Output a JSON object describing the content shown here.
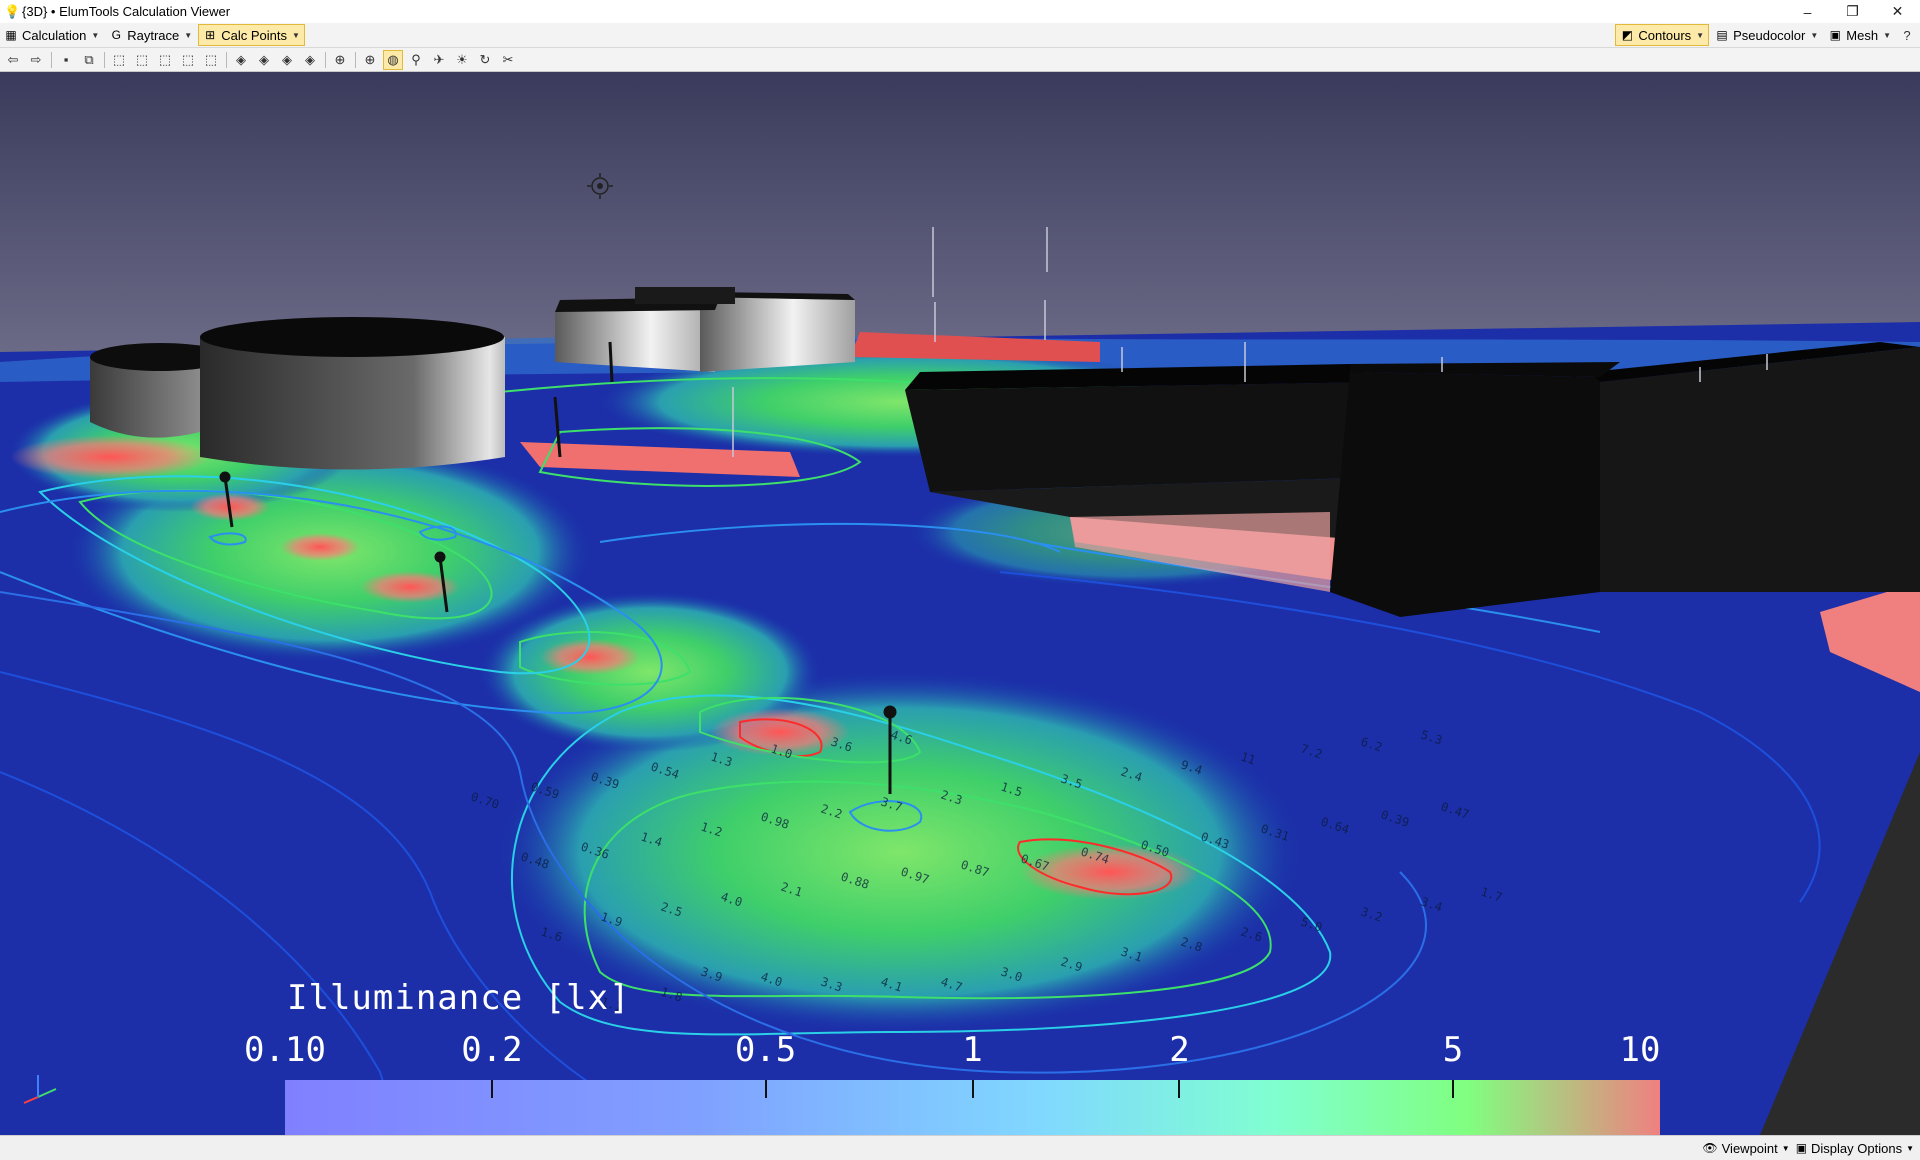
{
  "window": {
    "title": "{3D} • ElumTools Calculation Viewer",
    "controls": [
      "–",
      "❐",
      "✕"
    ]
  },
  "toolbar": {
    "left": [
      {
        "label": "Calculation",
        "icon": "calculator-icon",
        "glyph": "▦"
      },
      {
        "label": "Raytrace",
        "icon": "raytrace-icon",
        "glyph": "G"
      },
      {
        "label": "Calc Points",
        "icon": "grid-points-icon",
        "glyph": "⊞",
        "active": true
      }
    ],
    "right": [
      {
        "label": "Contours",
        "icon": "contours-icon",
        "glyph": "◩",
        "active": true
      },
      {
        "label": "Pseudocolor",
        "icon": "pseudocolor-icon",
        "glyph": "▤"
      },
      {
        "label": "Mesh",
        "icon": "mesh-icon",
        "glyph": "▣"
      }
    ],
    "help_glyph": "?"
  },
  "toolbar2": {
    "buttons": [
      {
        "name": "back-icon",
        "glyph": "⇦"
      },
      {
        "name": "forward-icon",
        "glyph": "⇨"
      },
      {
        "sep": true
      },
      {
        "name": "save-icon",
        "glyph": "▪"
      },
      {
        "name": "copy-icon",
        "glyph": "⧉"
      },
      {
        "sep": true
      },
      {
        "name": "view-top-icon",
        "glyph": "⬚"
      },
      {
        "name": "view-front-icon",
        "glyph": "⬚"
      },
      {
        "name": "view-side-icon",
        "glyph": "⬚"
      },
      {
        "name": "view-iso-icon",
        "glyph": "⬚"
      },
      {
        "name": "view-persp-icon",
        "glyph": "⬚"
      },
      {
        "sep": true
      },
      {
        "name": "orbit-icon",
        "glyph": "◈"
      },
      {
        "name": "pan-icon",
        "glyph": "◈"
      },
      {
        "name": "rotate-icon",
        "glyph": "◈"
      },
      {
        "name": "spin-icon",
        "glyph": "◈"
      },
      {
        "sep": true
      },
      {
        "name": "zoom-window-icon",
        "glyph": "⊕"
      },
      {
        "sep": true
      },
      {
        "name": "zoom-icon",
        "glyph": "⊕"
      },
      {
        "name": "globe-icon",
        "glyph": "◍",
        "active": true
      },
      {
        "name": "walk-icon",
        "glyph": "⚲"
      },
      {
        "name": "fly-icon",
        "glyph": "✈"
      },
      {
        "name": "lightbulb-icon",
        "glyph": "☀"
      },
      {
        "name": "refresh-icon",
        "glyph": "↻"
      },
      {
        "name": "scissors-icon",
        "glyph": "✂"
      }
    ]
  },
  "legend": {
    "title": "Illuminance [lx]",
    "ticks": [
      "0.10",
      "0.2",
      "0.5",
      "1",
      "2",
      "5",
      "10"
    ]
  },
  "scene_labels": [
    "1.1",
    "1.8",
    "3.9",
    "4.0",
    "3.3",
    "4.1",
    "4.7",
    "3.0",
    "2.9",
    "3.1",
    "2.8",
    "2.6",
    "5.0",
    "3.2",
    "3.4",
    "1.7",
    "1.6",
    "1.9",
    "2.5",
    "4.0",
    "2.1",
    "0.88",
    "0.97",
    "0.87",
    "0.67",
    "0.74",
    "0.50",
    "0.43",
    "0.31",
    "0.64",
    "0.39",
    "0.47",
    "0.48",
    "0.36",
    "1.4",
    "1.2",
    "0.98",
    "2.2",
    "3.7",
    "2.3",
    "1.5",
    "3.5",
    "2.4",
    "9.4",
    "11",
    "7.2",
    "6.2",
    "5.3",
    "0.70",
    "0.59",
    "0.39",
    "0.54",
    "1.3",
    "1.0",
    "3.6",
    "4.6"
  ],
  "statusbar": {
    "viewpoint": "Viewpoint",
    "display_options": "Display Options"
  }
}
